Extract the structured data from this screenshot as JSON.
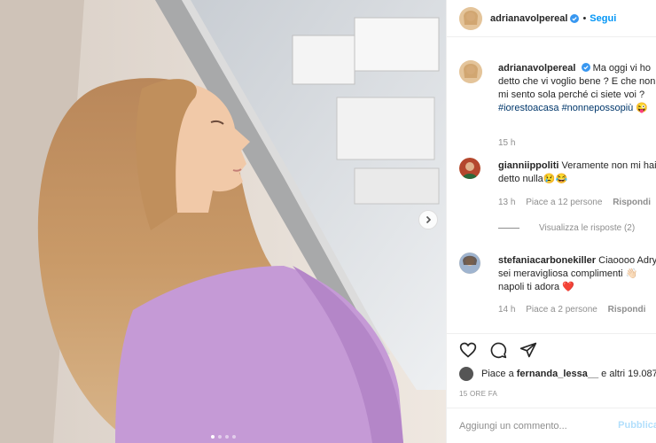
{
  "post": {
    "images_count": 4,
    "active_image": 1
  },
  "header": {
    "username": "adrianavolpereal",
    "separator": "•",
    "follow_label": "Segui"
  },
  "caption": {
    "username": "adrianavolpereal",
    "text": "Ma oggi vi ho detto che vi voglio bene ? E che non mi sento sola perché ci siete voi ?",
    "hashtag1": "#iorestoacasa",
    "hashtag2": "#nonnepossopiù",
    "emoji": "😜",
    "time": "15 h"
  },
  "comments": [
    {
      "username": "gianniippoliti",
      "text": "Veramente non mi hai detto nulla😢😂",
      "time": "13 h",
      "likes": "Piace a 12 persone",
      "reply": "Rispondi",
      "view_replies": "Visualizza le risposte (2)"
    },
    {
      "username": "stefaniacarbonekiller",
      "text": "Ciaoooo Adry sei meravigliosa complimenti 👋🏻 napoli ti adora ❤️",
      "time": "14 h",
      "likes": "Piace a 2 persone",
      "reply": "Rispondi"
    }
  ],
  "likes": {
    "prefix": "Piace a",
    "user": "fernanda_lessa__",
    "suffix": "e altri 19.087"
  },
  "timeago": "15 ORE FA",
  "add_comment": {
    "placeholder": "Aggiungi un commento...",
    "publish": "Pubblica"
  },
  "icons": [
    "heart-icon",
    "comment-icon",
    "share-icon",
    "verified-icon",
    "chevron-right-icon"
  ],
  "colors": {
    "link": "#0095f6",
    "hashtag": "#00376b",
    "muted": "#8e8e8e"
  }
}
